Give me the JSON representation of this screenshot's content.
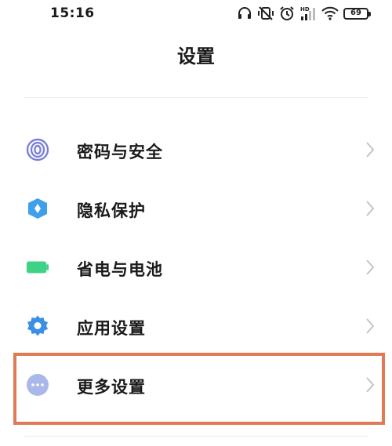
{
  "status_bar": {
    "time": "15:16",
    "battery_level": "69",
    "hd_label": "HD",
    "icons": [
      "headphones-icon",
      "mute-vibrate-icon",
      "alarm-icon",
      "signal-icon",
      "wifi-icon",
      "battery-icon"
    ]
  },
  "header": {
    "title": "设置"
  },
  "settings": {
    "items": [
      {
        "label": "密码与安全",
        "icon": "fingerprint-icon",
        "color": "#7a80d8"
      },
      {
        "label": "隐私保护",
        "icon": "privacy-shield-icon",
        "color": "#3ea0ea"
      },
      {
        "label": "省电与电池",
        "icon": "battery-icon",
        "color": "#3fd287"
      },
      {
        "label": "应用设置",
        "icon": "gear-icon",
        "color": "#3b8fe4"
      },
      {
        "label": "更多设置",
        "icon": "more-dots-icon",
        "color": "#a9b8e8"
      }
    ]
  },
  "highlight_color": "#e07a56"
}
